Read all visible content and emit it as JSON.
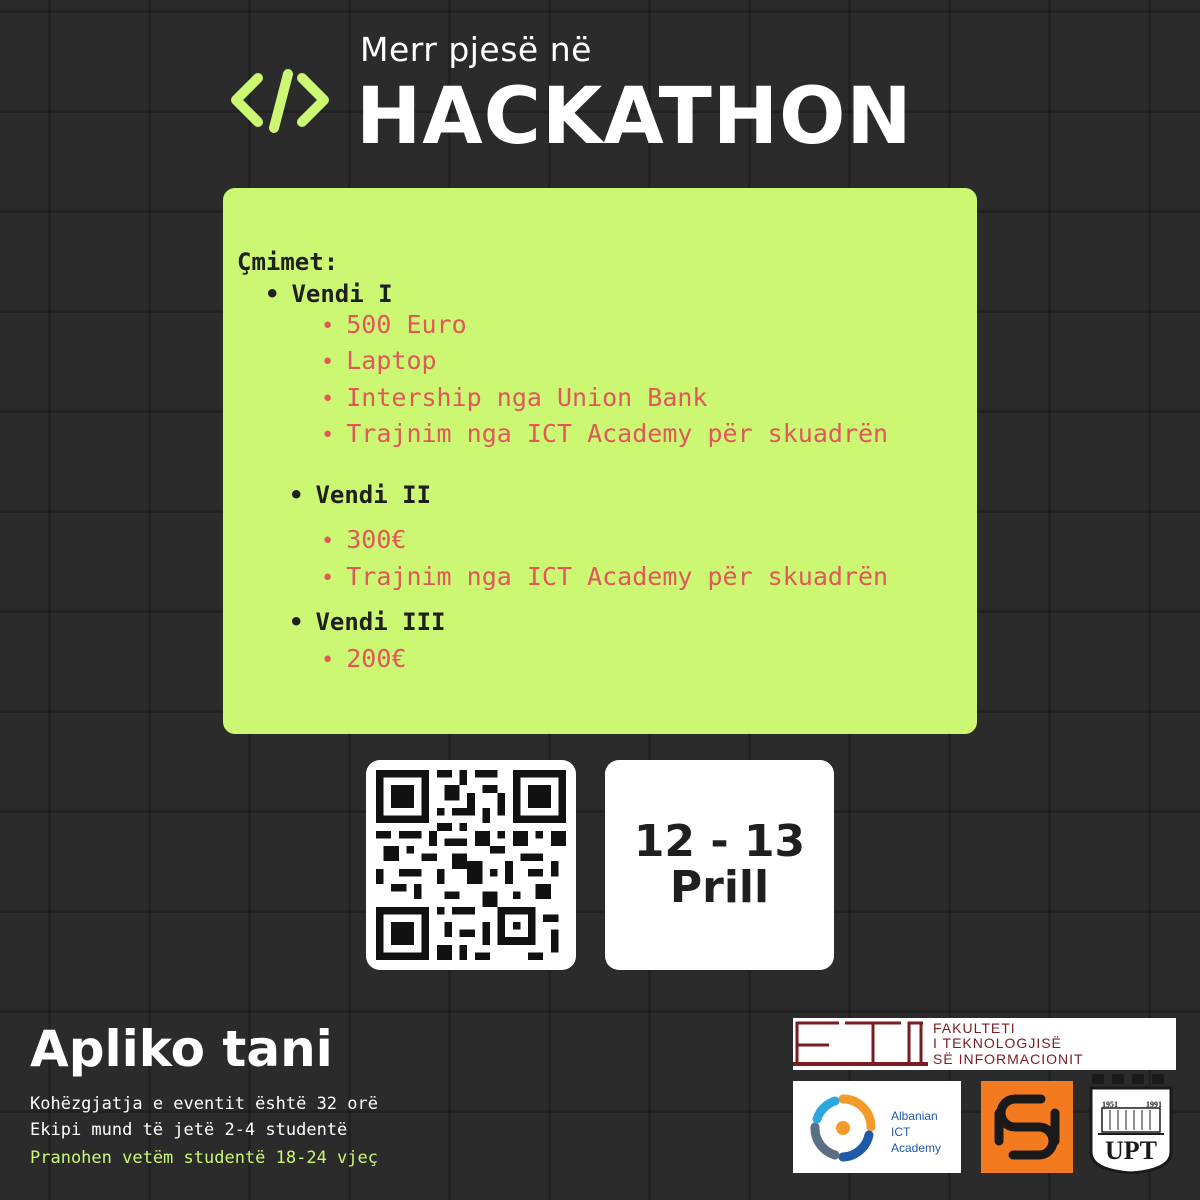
{
  "header": {
    "subtitle": "Merr pjesë në",
    "title": "HACKATHON",
    "icon": "code-brackets-icon",
    "accent_color": "#ccf772"
  },
  "prizes": {
    "heading": "Çmimet:",
    "levels": [
      {
        "name": "Vendi I",
        "items": [
          "500 Euro",
          "Laptop",
          "Intership nga Union Bank",
          "Trajnim nga ICT Academy për skuadrën"
        ]
      },
      {
        "name": "Vendi II",
        "items": [
          "300€",
          "Trajnim nga ICT Academy për skuadrën"
        ]
      },
      {
        "name": "Vendi III",
        "items": [
          "200€"
        ]
      }
    ],
    "card_color": "#ccf772",
    "item_color": "#e0585a"
  },
  "qr": {
    "icon": "qr-code-icon"
  },
  "date": {
    "range": "12 - 13",
    "month": "Prill"
  },
  "footer": {
    "apply_title": "Apliko tani",
    "lines": [
      "Kohëzgjatja e eventit është 32 orë",
      "Ekipi mund të jetë 2-4 studentë",
      "Pranohen vetëm studentë 18-24 vjeç"
    ]
  },
  "logos": {
    "fti": {
      "lines": [
        "FAKULTETI",
        "I TEKNOLOGJISË",
        "SË INFORMACIONIT"
      ],
      "color": "#7a1c22"
    },
    "ict_academy": {
      "lines": [
        "Albanian",
        "ICT",
        "Academy"
      ],
      "color": "#1f5aa8"
    },
    "chain": {
      "color": "#f47a1f",
      "icon": "chain-link-icon"
    },
    "upt": {
      "text": "UPT",
      "years": [
        "1951",
        "1991"
      ]
    }
  }
}
